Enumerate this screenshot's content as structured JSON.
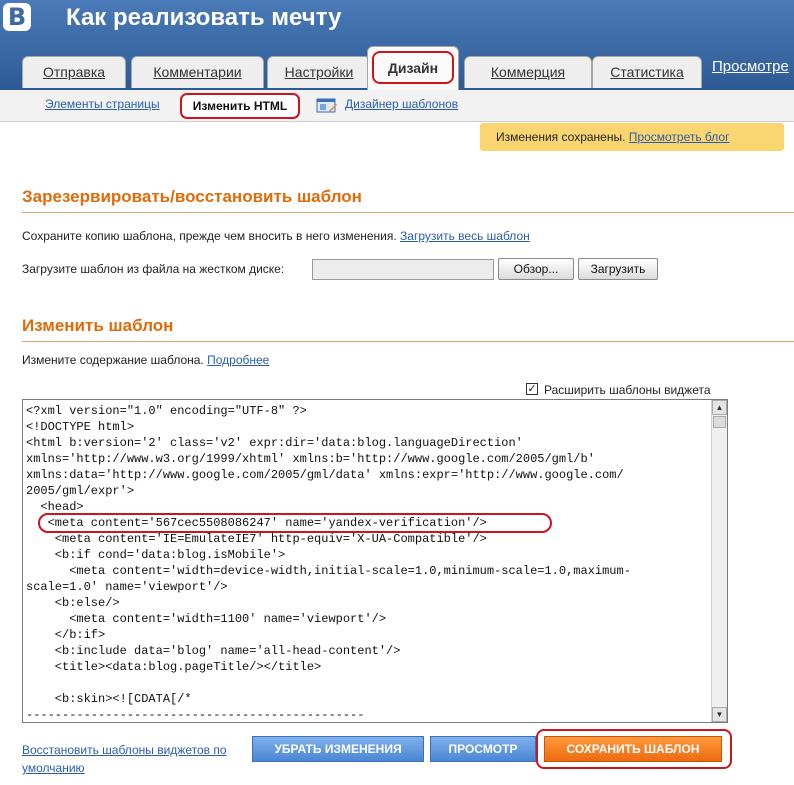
{
  "header": {
    "logo": "B",
    "title": "Как реализовать мечту"
  },
  "tabs": [
    {
      "label": "Отправка"
    },
    {
      "label": "Комментарии"
    },
    {
      "label": "Настройки"
    },
    {
      "label": "Дизайн",
      "active": true
    },
    {
      "label": "Коммерция"
    },
    {
      "label": "Статистика"
    }
  ],
  "tab_preview": "Просмотре",
  "subnav": {
    "page_elements": "Элементы страницы",
    "edit_html": "Изменить HTML",
    "template_designer": "Дизайнер шаблонов"
  },
  "notice": {
    "text": "Изменения сохранены.",
    "link": "Просмотреть блог"
  },
  "backup": {
    "title": "Зарезервировать/восстановить шаблон",
    "save_text": "Сохраните копию шаблона, прежде чем вносить в него изменения.",
    "download_link": "Загрузить весь шаблон",
    "upload_text": "Загрузите шаблон из файла на жестком диске:",
    "browse_button": "Обзор...",
    "upload_button": "Загрузить"
  },
  "edit": {
    "title": "Изменить шаблон",
    "text": "Измените содержание шаблона.",
    "more_link": "Подробнее",
    "expand_label": "Расширить шаблоны виджета",
    "expand_checked": true,
    "code_lines": [
      "<?xml version=\"1.0\" encoding=\"UTF-8\" ?>",
      "<!DOCTYPE html>",
      "<html b:version='2' class='v2' expr:dir='data:blog.languageDirection'",
      "xmlns='http://www.w3.org/1999/xhtml' xmlns:b='http://www.google.com/2005/gml/b'",
      "xmlns:data='http://www.google.com/2005/gml/data' xmlns:expr='http://www.google.com/",
      "2005/gml/expr'>",
      "  <head>",
      "   <meta content='567cec5508086247' name='yandex-verification'/>",
      "    <meta content='IE=EmulateIE7' http-equiv='X-UA-Compatible'/>",
      "    <b:if cond='data:blog.isMobile'>",
      "      <meta content='width=device-width,initial-scale=1.0,minimum-scale=1.0,maximum-",
      "scale=1.0' name='viewport'/>",
      "    <b:else/>",
      "      <meta content='width=1100' name='viewport'/>",
      "    </b:if>",
      "    <b:include data='blog' name='all-head-content'/>",
      "    <title><data:blog.pageTitle/></title>",
      "",
      "    <b:skin><![CDATA[/*",
      "-----------------------------------------------"
    ]
  },
  "bottom": {
    "restore_link": "Восстановить шаблоны виджетов по умолчанию",
    "discard_button": "УБРАТЬ ИЗМЕНЕНИЯ",
    "preview_button": "ПРОСМОТР",
    "save_button": "СОХРАНИТЬ ШАБЛОН"
  },
  "colors": {
    "header": "#3d6aa4",
    "accent": "#e06b0b",
    "highlight": "#d0141b",
    "notice": "#fbd56f",
    "link": "#2a5db0"
  }
}
